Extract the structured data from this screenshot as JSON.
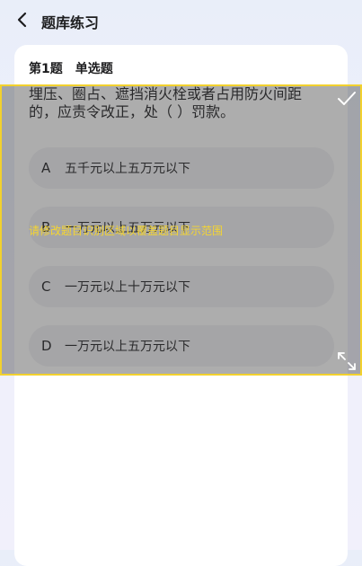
{
  "header": {
    "title": "题库练习"
  },
  "question": {
    "number": "第1题",
    "type": "单选题",
    "text": "埋压、圈占、遮挡消火栓或者占用防火间距的，应责令改正，处（ ）罚款。",
    "options": [
      {
        "letter": "A",
        "text": "五千元以上五万元以下"
      },
      {
        "letter": "B",
        "text": "一万元以上五万元以下"
      },
      {
        "letter": "C",
        "text": "一万元以上十万元以下"
      },
      {
        "letter": "D",
        "text": "一万元以上五万元以下"
      }
    ]
  },
  "overlay": {
    "hint": "请修改题目识别区域以覆盖题目显示范围",
    "border_color": "#f2d12e",
    "hint_color": "#f5d531",
    "icons": [
      "check-icon",
      "expand-icon"
    ]
  },
  "icons": {
    "back": "chevron-left-icon"
  }
}
